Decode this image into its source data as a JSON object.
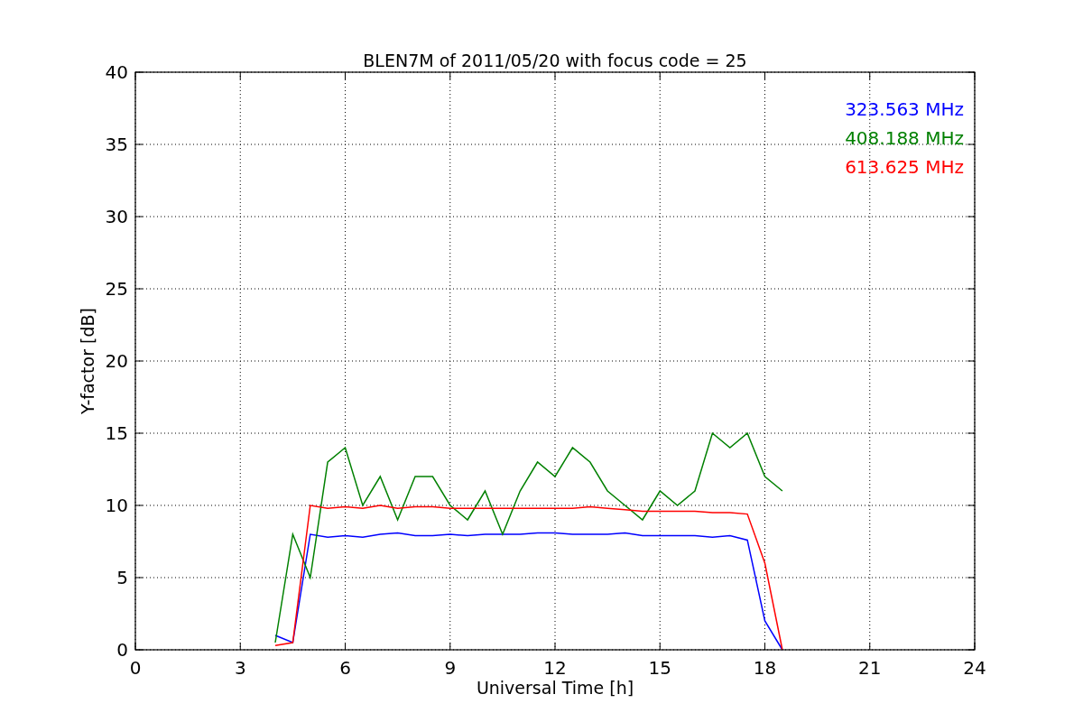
{
  "figure": {
    "chart_data": {
      "type": "line",
      "title": "BLEN7M of 2011/05/20 with focus code = 25",
      "xlabel": "Universal Time [h]",
      "ylabel": "Y-factor [dB]",
      "x": [
        4,
        4.5,
        5,
        5.5,
        6,
        6.5,
        7,
        7.5,
        8,
        8.5,
        9,
        9.5,
        10,
        10.5,
        11,
        11.5,
        12,
        12.5,
        13,
        13.5,
        14,
        14.5,
        15,
        15.5,
        16,
        16.5,
        17,
        17.5,
        18,
        18.5
      ],
      "series": [
        {
          "name": "323.563 MHz",
          "color": "#0000ff",
          "values": [
            1.0,
            0.5,
            8.0,
            7.8,
            7.9,
            7.8,
            8.0,
            8.1,
            7.9,
            7.9,
            8.0,
            7.9,
            8.0,
            8.0,
            8.0,
            8.1,
            8.1,
            8.0,
            8.0,
            8.0,
            8.1,
            7.9,
            7.9,
            7.9,
            7.9,
            7.8,
            7.9,
            7.6,
            2.0,
            0.0
          ]
        },
        {
          "name": "408.188 MHz",
          "color": "#008000",
          "values": [
            0.5,
            8.0,
            5.0,
            13.0,
            14.0,
            10.0,
            12.0,
            9.0,
            12.0,
            12.0,
            10.0,
            9.0,
            11.0,
            8.0,
            11.0,
            13.0,
            12.0,
            14.0,
            13.0,
            11.0,
            10.0,
            9.0,
            11.0,
            10.0,
            11.0,
            15.0,
            14.0,
            15.0,
            12.0,
            11.0
          ]
        },
        {
          "name": "613.625 MHz",
          "color": "#ff0000",
          "values": [
            0.3,
            0.5,
            10.0,
            9.8,
            9.9,
            9.8,
            10.0,
            9.8,
            9.9,
            9.9,
            9.8,
            9.8,
            9.8,
            9.8,
            9.8,
            9.8,
            9.8,
            9.8,
            9.9,
            9.8,
            9.7,
            9.6,
            9.6,
            9.6,
            9.6,
            9.5,
            9.5,
            9.4,
            6.0,
            0.0
          ]
        }
      ],
      "xlim": [
        0,
        24
      ],
      "ylim": [
        0,
        40
      ],
      "grid": true,
      "xticks": [
        0,
        3,
        6,
        9,
        12,
        15,
        18,
        21,
        24
      ],
      "yticks": [
        0,
        5,
        10,
        15,
        20,
        25,
        30,
        35,
        40
      ]
    }
  }
}
